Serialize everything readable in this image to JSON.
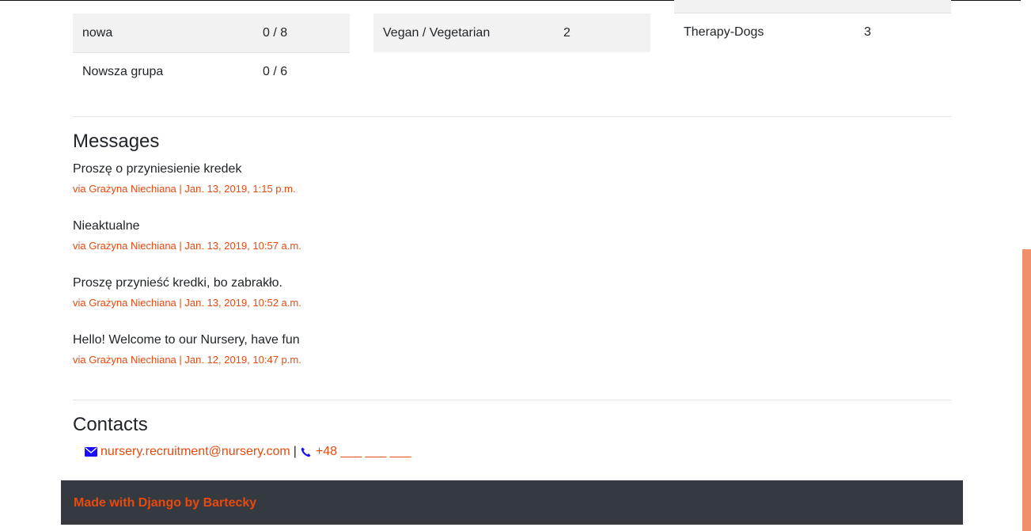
{
  "groups_table": [
    {
      "name": "nowa",
      "value": "0 / 8"
    },
    {
      "name": "Nowsza grupa",
      "value": "0 / 6"
    }
  ],
  "diets_table": [
    {
      "name": "Vegan / Vegetarian",
      "value": "2"
    }
  ],
  "activities_table": [
    {
      "name": "Therapy-Dogs",
      "value": "3"
    }
  ],
  "messages": {
    "heading": "Messages",
    "items": [
      {
        "text": "Proszę o przyniesienie kredek",
        "meta": "via Grażyna Niechiana | Jan. 13, 2019, 1:15 p.m."
      },
      {
        "text": "Nieaktualne",
        "meta": "via Grażyna Niechiana | Jan. 13, 2019, 10:57 a.m."
      },
      {
        "text": "Proszę przynieść kredki, bo zabrakło.",
        "meta": "via Grażyna Niechiana | Jan. 13, 2019, 10:52 a.m."
      },
      {
        "text": "Hello! Welcome to our Nursery, have fun",
        "meta": "via Grażyna Niechiana | Jan. 12, 2019, 10:47 p.m."
      }
    ]
  },
  "contacts": {
    "heading": "Contacts",
    "email": "nursery.recruitment@nursery.com",
    "separator": "|",
    "phone": "+48 ___ ___ ___",
    "email_icon": "envelope-icon",
    "phone_icon": "phone-icon"
  },
  "footer": {
    "text": "Made with Django by Bartecky"
  },
  "colors": {
    "accent": "#e8490f",
    "footer_bg": "#343a40",
    "scrollbar_thumb": "#f0906a"
  }
}
